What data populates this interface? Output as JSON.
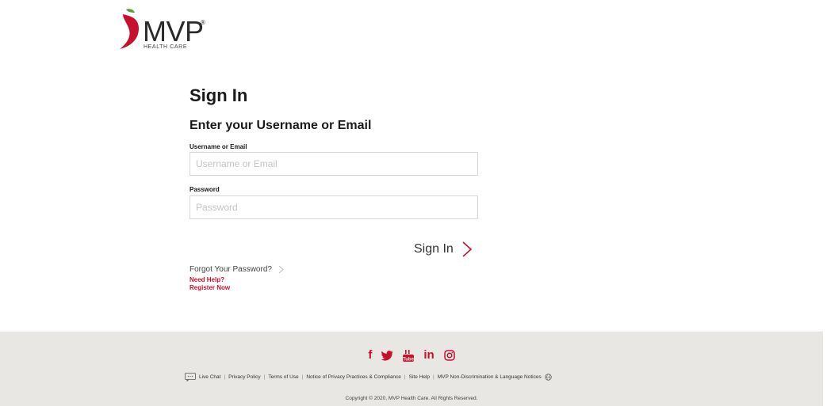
{
  "logo": {
    "brand": "MVP",
    "trademark": "®",
    "tagline": "HEALTH CARE",
    "icon": "mvp-apple-logo"
  },
  "signin": {
    "title": "Sign In",
    "subtitle": "Enter your Username or Email",
    "username_label": "Username or Email",
    "username_placeholder": "Username or Email",
    "username_value": "",
    "password_label": "Password",
    "password_placeholder": "Password",
    "password_value": "",
    "submit_label": "Sign In",
    "submit_icon": "chevron-right-icon",
    "forgot_label": "Forgot Your Password?",
    "need_help_label": "Need Help?",
    "register_label": "Register Now"
  },
  "footer": {
    "social": [
      {
        "icon": "facebook-icon",
        "glyph": "f"
      },
      {
        "icon": "twitter-icon",
        "glyph": "🐦"
      },
      {
        "icon": "youtube-icon",
        "glyph": "▶"
      },
      {
        "icon": "linkedin-icon",
        "glyph": "in"
      },
      {
        "icon": "instagram-icon",
        "glyph": "◎"
      }
    ],
    "links": [
      "Live Chat",
      "Privacy Policy",
      "Terms of Use",
      "Notice of Privacy Practices & Compliance",
      "Site Help",
      "MVP Non-Discrimination & Language Notices"
    ],
    "copyright": "Copyright © 2020, MVP Health Care. All Rights Reserved."
  },
  "colors": {
    "accent": "#c8102e",
    "leaf": "#5a9e2f",
    "footer_bg": "#e9e7e3",
    "field_border": "#d6d6d6"
  }
}
